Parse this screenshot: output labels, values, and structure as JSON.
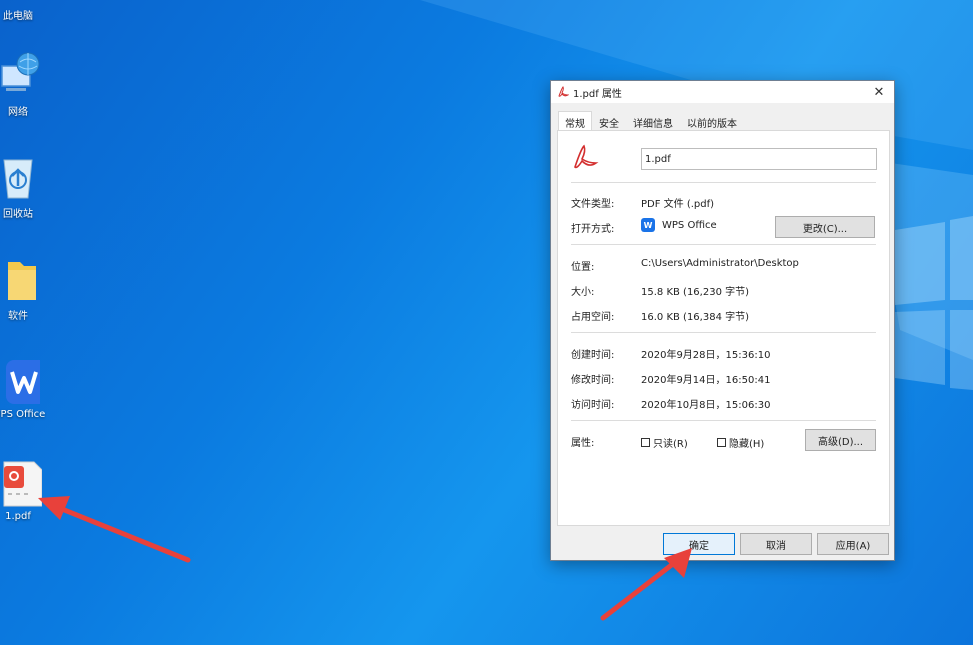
{
  "desktop": {
    "icons": [
      {
        "label": "此电脑"
      },
      {
        "label": "网络"
      },
      {
        "label": "回收站"
      },
      {
        "label": "软件"
      },
      {
        "label": "WPS Office"
      },
      {
        "label": "1.pdf"
      }
    ]
  },
  "dialog": {
    "title": "1.pdf 属性",
    "close_glyph": "✕",
    "tabs": [
      "常规",
      "安全",
      "详细信息",
      "以前的版本"
    ],
    "filename": "1.pdf",
    "fields": {
      "type_label": "文件类型:",
      "type_value": "PDF 文件 (.pdf)",
      "open_label": "打开方式:",
      "open_value": "WPS Office",
      "change_button": "更改(C)...",
      "location_label": "位置:",
      "location_value": "C:\\Users\\Administrator\\Desktop",
      "size_label": "大小:",
      "size_value": "15.8 KB (16,230 字节)",
      "disk_label": "占用空间:",
      "disk_value": "16.0 KB (16,384 字节)",
      "created_label": "创建时间:",
      "created_value": "2020年9月28日，15:36:10",
      "modified_label": "修改时间:",
      "modified_value": "2020年9月14日，16:50:41",
      "accessed_label": "访问时间:",
      "accessed_value": "2020年10月8日，15:06:30",
      "attr_label": "属性:",
      "readonly_label": "只读(R)",
      "hidden_label": "隐藏(H)",
      "advanced_button": "高级(D)..."
    },
    "buttons": {
      "ok": "确定",
      "cancel": "取消",
      "apply": "应用(A)"
    }
  },
  "colors": {
    "annotation_arrow": "#e8413b",
    "desktop_blue": "#0b7be0"
  }
}
